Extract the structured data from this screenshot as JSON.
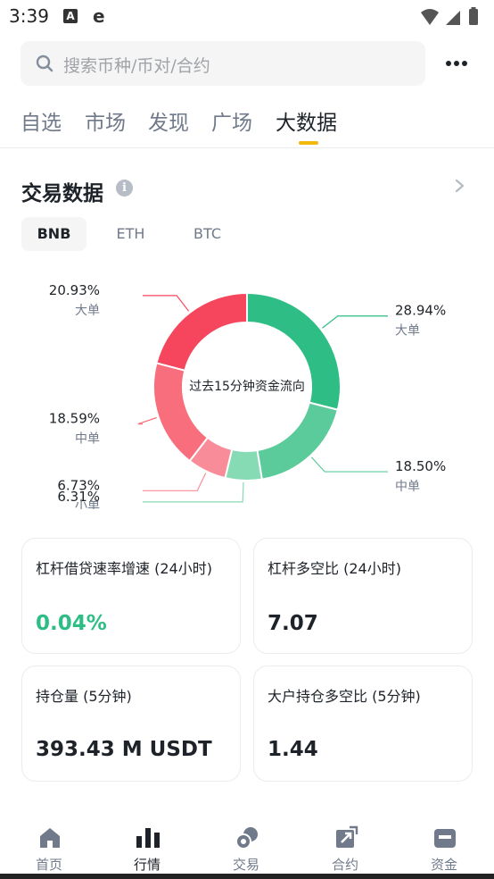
{
  "status_bar": {
    "time": "3:39",
    "icons": [
      "a-notification-icon",
      "browser-e-icon",
      "wifi-icon",
      "signal-icon",
      "battery-icon"
    ]
  },
  "search": {
    "placeholder": "搜索币种/币对/合约",
    "icon": "search-icon"
  },
  "more_icon": "more-dots-icon",
  "tabs": [
    {
      "label": "自选",
      "active": false
    },
    {
      "label": "市场",
      "active": false
    },
    {
      "label": "发现",
      "active": false
    },
    {
      "label": "广场",
      "active": false
    },
    {
      "label": "大数据",
      "active": true
    }
  ],
  "section": {
    "title": "交易数据",
    "info_glyph": "i"
  },
  "coins": [
    {
      "label": "BNB",
      "active": true
    },
    {
      "label": "ETH",
      "active": false
    },
    {
      "label": "BTC",
      "active": false
    }
  ],
  "donut": {
    "center_label": "过去15分钟资金流向",
    "inflow": [
      {
        "percent": "28.94%",
        "label": "大单",
        "value": 28.94,
        "color": "#2ebd85"
      },
      {
        "percent": "18.50%",
        "label": "中单",
        "value": 18.5,
        "color": "#5ccb9b"
      },
      {
        "percent": "6.31%",
        "label": "小单",
        "value": 6.31,
        "color": "#86dbb5"
      }
    ],
    "outflow": [
      {
        "percent": "20.93%",
        "label": "大单",
        "value": 20.93,
        "color": "#f6465d"
      },
      {
        "percent": "18.59%",
        "label": "中单",
        "value": 18.59,
        "color": "#f86e7d"
      },
      {
        "percent": "6.73%",
        "label": "小单",
        "value": 6.73,
        "color": "#f98c99"
      }
    ]
  },
  "cards": [
    {
      "title": "杠杆借贷速率增速 (24小时)",
      "value": "0.04%",
      "positive": true
    },
    {
      "title": "杠杆多空比 (24小时)",
      "value": "7.07",
      "positive": false
    },
    {
      "title": "持仓量 (5分钟)",
      "value": "393.43 M USDT",
      "positive": false
    },
    {
      "title": "大户持仓多空比 (5分钟)",
      "value": "1.44",
      "positive": false
    }
  ],
  "bottom_nav": [
    {
      "label": "首页",
      "icon": "home-icon",
      "active": false
    },
    {
      "label": "行情",
      "icon": "markets-bar-chart-icon",
      "active": true
    },
    {
      "label": "交易",
      "icon": "trade-coins-icon",
      "active": false
    },
    {
      "label": "合约",
      "icon": "futures-icon",
      "active": false
    },
    {
      "label": "资金",
      "icon": "wallet-icon",
      "active": false
    }
  ],
  "colors": {
    "accent": "#f0b90b",
    "up": "#2ebd85",
    "down": "#f6465d"
  }
}
